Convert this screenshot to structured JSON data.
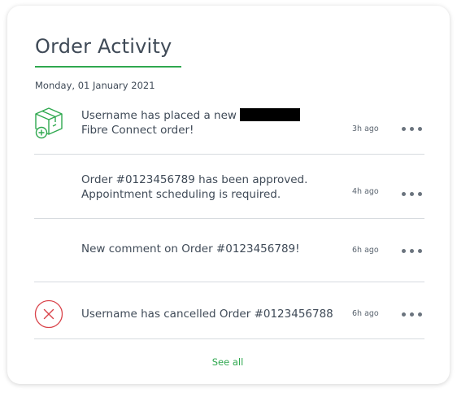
{
  "card": {
    "title": "Order Activity",
    "accent_color": "#2fa84f",
    "date_label": "Monday, 01 January 2021",
    "see_all_label": "See all"
  },
  "activities": [
    {
      "icon": "package-add-icon",
      "line1": "Username has placed a new",
      "line2": "Fibre Connect order!",
      "has_redaction": true,
      "time": "3h ago"
    },
    {
      "icon": "",
      "line1": "Order #0123456789 has been approved.",
      "line2": "Appointment scheduling is required.",
      "time": "4h ago"
    },
    {
      "icon": "",
      "line1": "New comment on Order #0123456789!",
      "time": "6h ago"
    },
    {
      "icon": "cancel-icon",
      "line1": "Username has cancelled Order #0123456788",
      "time": "6h ago"
    }
  ],
  "colors": {
    "text": "#3f4a57",
    "divider": "#d7dbdf",
    "cancel_red": "#d9434a"
  }
}
